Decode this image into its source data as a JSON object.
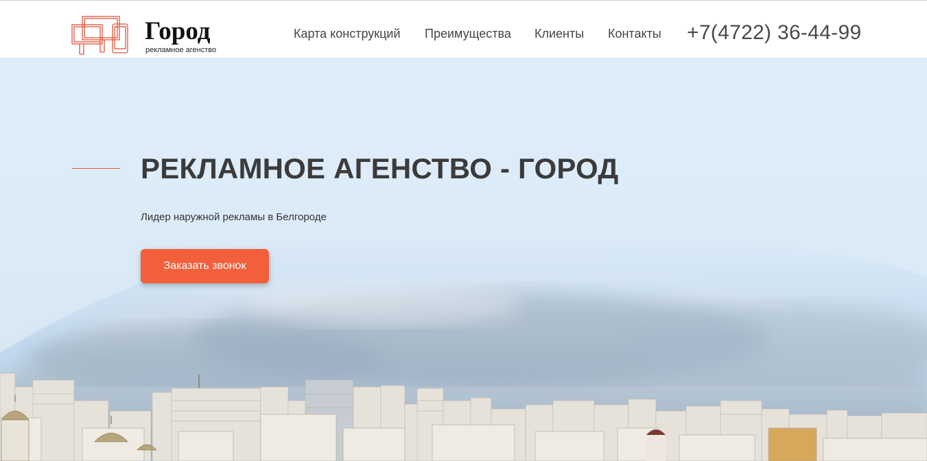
{
  "header": {
    "logo": {
      "icon": "billboard-screens-icon",
      "title": "Город",
      "subtitle": "рекламное агенство"
    },
    "nav": [
      {
        "label": "Карта конструкций"
      },
      {
        "label": "Преимущества"
      },
      {
        "label": "Клиенты"
      },
      {
        "label": "Контакты"
      }
    ],
    "phone": "+7(4722) 36-44-99"
  },
  "hero": {
    "title": "РЕКЛАМНОЕ АГЕНСТВО - ГОРОД",
    "subtitle": "Лидер наружной рекламы в Белгороде",
    "cta_label": "Заказать звонок",
    "background": "city-skyline-photo"
  },
  "colors": {
    "accent": "#f25f3b",
    "logo_line": "#e0553a",
    "sky": "#deedf9",
    "text_dark": "#3b3b3b"
  }
}
